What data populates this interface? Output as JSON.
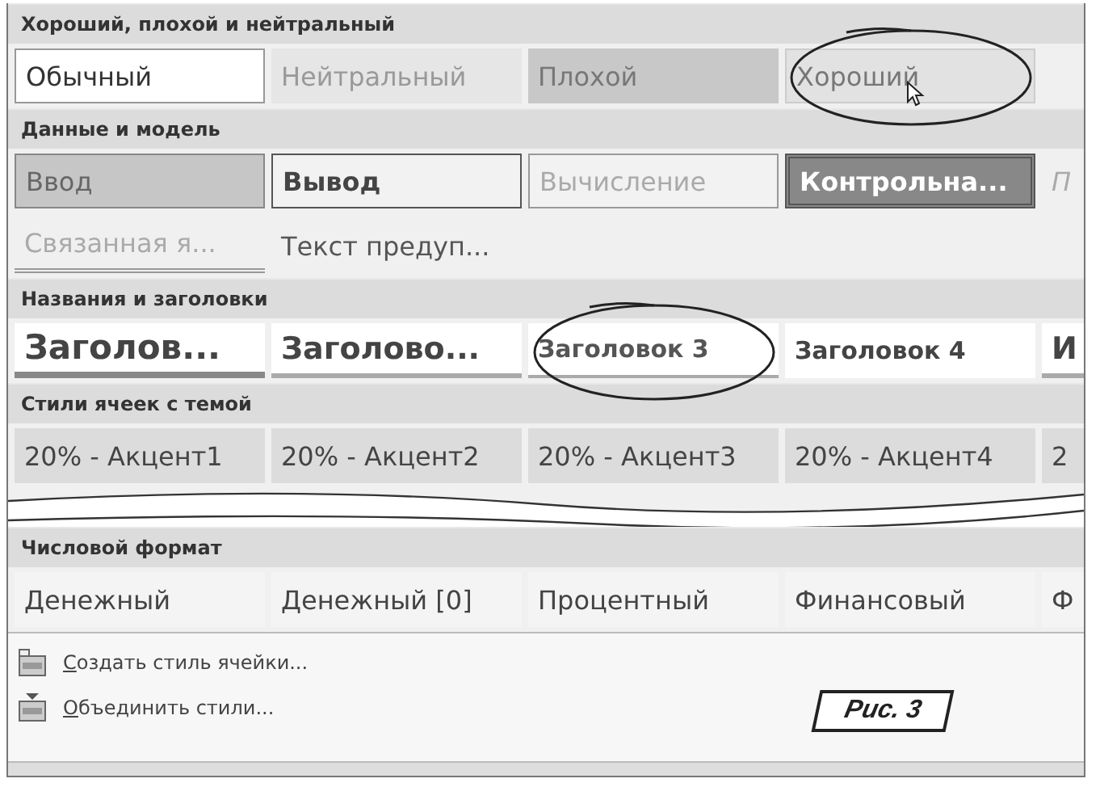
{
  "sections": [
    {
      "title": "Хороший, плохой и нейтральный",
      "rows": [
        [
          {
            "label": "Обычный",
            "kind": "normal"
          },
          {
            "label": "Нейтральный",
            "kind": "neutral"
          },
          {
            "label": "Плохой",
            "kind": "bad"
          },
          {
            "label": "Хороший",
            "kind": "good",
            "circled": true,
            "hover": true
          }
        ]
      ]
    },
    {
      "title": "Данные и модель",
      "rows": [
        [
          {
            "label": "Ввод",
            "kind": "input"
          },
          {
            "label": "Вывод",
            "kind": "output"
          },
          {
            "label": "Вычисление",
            "kind": "calc"
          },
          {
            "label": "Контрольна...",
            "kind": "check"
          },
          {
            "label": "П",
            "kind": "note"
          }
        ],
        [
          {
            "label": "Связанная я...",
            "kind": "linked"
          },
          {
            "label": "Текст предуп...",
            "kind": "warning"
          }
        ]
      ]
    },
    {
      "title": "Названия и заголовки",
      "rows": [
        [
          {
            "label": "Заголов...",
            "kind": "h1"
          },
          {
            "label": "Заголово...",
            "kind": "h2"
          },
          {
            "label": "Заголовок 3",
            "kind": "h3",
            "circled": true
          },
          {
            "label": "Заголовок 4",
            "kind": "h4"
          },
          {
            "label": "И",
            "kind": "title"
          }
        ]
      ]
    },
    {
      "title": "Стили ячеек с темой",
      "torn": true,
      "rows": [
        [
          {
            "label": "20% - Акцент1",
            "kind": "accent"
          },
          {
            "label": "20% - Акцент2",
            "kind": "accent"
          },
          {
            "label": "20% - Акцент3",
            "kind": "accent"
          },
          {
            "label": "20% - Акцент4",
            "kind": "accent"
          },
          {
            "label": "2",
            "kind": "accent"
          }
        ]
      ]
    },
    {
      "title": "Числовой формат",
      "rows": [
        [
          {
            "label": "Денежный",
            "kind": "number"
          },
          {
            "label": "Денежный [0]",
            "kind": "number"
          },
          {
            "label": "Процентный",
            "kind": "number"
          },
          {
            "label": "Финансовый",
            "kind": "number"
          },
          {
            "label": "Ф",
            "kind": "number"
          }
        ]
      ]
    }
  ],
  "menu": [
    {
      "label": "Создать стиль ячейки...",
      "kind": "new"
    },
    {
      "label": "Объединить стили...",
      "kind": "merge"
    }
  ],
  "caption": "Рис. 3"
}
